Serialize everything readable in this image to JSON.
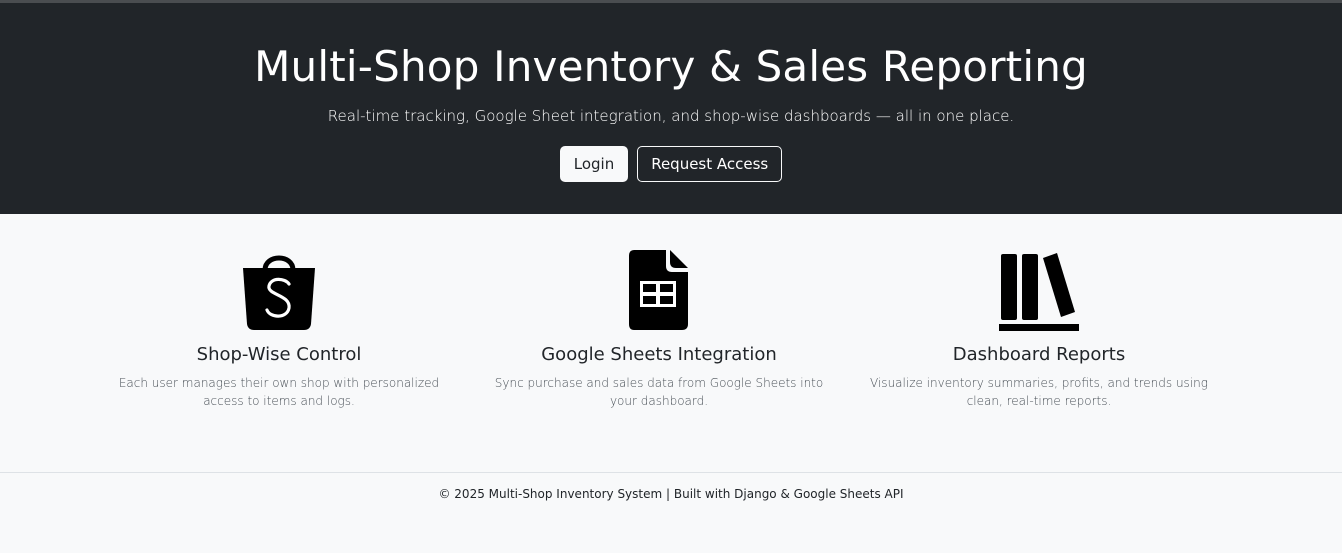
{
  "hero": {
    "title": "Multi-Shop Inventory & Sales Reporting",
    "subtitle": "Real-time tracking, Google Sheet integration, and shop-wise dashboards — all in one place.",
    "login_label": "Login",
    "request_access_label": "Request Access"
  },
  "features": [
    {
      "icon": "shopping-bag-icon",
      "title": "Shop-Wise Control",
      "description": "Each user manages their own shop with personalized access to items and logs."
    },
    {
      "icon": "spreadsheet-file-icon",
      "title": "Google Sheets Integration",
      "description": "Sync purchase and sales data from Google Sheets into your dashboard."
    },
    {
      "icon": "bookshelf-icon",
      "title": "Dashboard Reports",
      "description": "Visualize inventory summaries, profits, and trends using clean, real-time reports."
    }
  ],
  "footer": {
    "text": "© 2025 Multi-Shop Inventory System | Built with Django & Google Sheets API"
  },
  "colors": {
    "hero_background": "#212529",
    "page_background": "#f8f9fa",
    "text": "#212529"
  }
}
